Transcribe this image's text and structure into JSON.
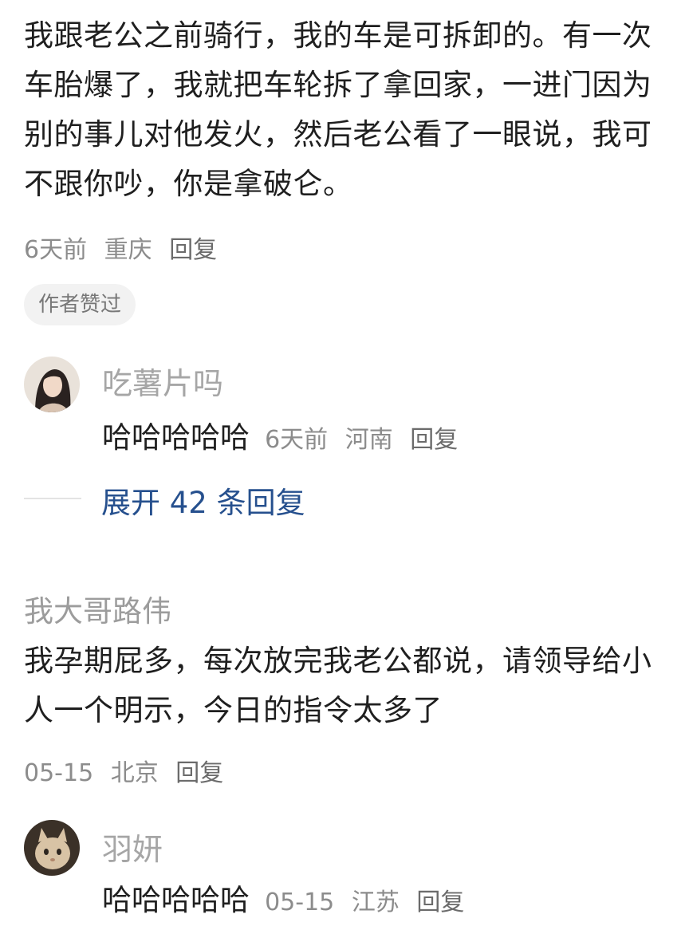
{
  "comments": [
    {
      "text": "我跟老公之前骑行，我的车是可拆卸的。有一次车胎爆了，我就把车轮拆了拿回家，一进门因为别的事儿对他发火，然后老公看了一眼说，我可不跟你吵，你是拿破仑。",
      "time": "6天前",
      "location": "重庆",
      "reply_label": "回复",
      "badge": "作者赞过",
      "sub_reply": {
        "name": "吃薯片吗",
        "text": "哈哈哈哈哈",
        "time": "6天前",
        "location": "河南",
        "reply_label": "回复",
        "avatar_icon": "user-avatar-photo"
      },
      "expand_label": "展开 42 条回复"
    },
    {
      "username": "我大哥路伟",
      "text": "我孕期屁多，每次放完我老公都说，请领导给小人一个明示，今日的指令太多了",
      "time": "05-15",
      "location": "北京",
      "reply_label": "回复",
      "sub_reply": {
        "name": "羽妍",
        "text": "哈哈哈哈哈",
        "time": "05-15",
        "location": "江苏",
        "reply_label": "回复",
        "avatar_icon": "cat-avatar-photo"
      }
    }
  ],
  "colors": {
    "text": "#1f1f1f",
    "meta": "#8c8c8c",
    "link": "#26508e",
    "badge_bg": "#f2f2f2"
  }
}
